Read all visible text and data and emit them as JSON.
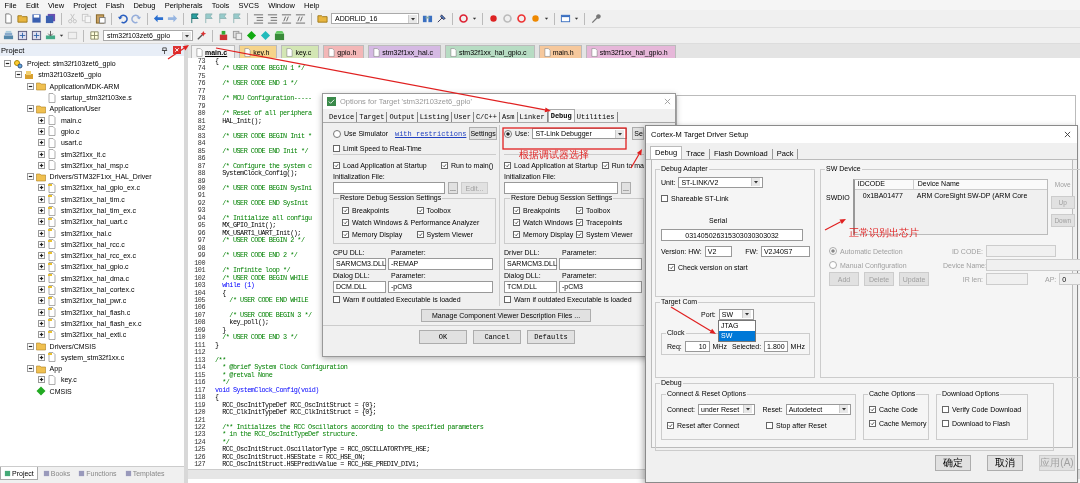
{
  "menu_bar": [
    "File",
    "Edit",
    "View",
    "Project",
    "Flash",
    "Debug",
    "Peripherals",
    "Tools",
    "SVCS",
    "Window",
    "Help"
  ],
  "toolbar": {
    "address_combo": "ADDRLID_16",
    "target_combo": "stm32f103zet6_gpio"
  },
  "project_panel": {
    "title": "Project",
    "tree": [
      {
        "label": "Project: stm32f103zet6_gpio",
        "kind": "project",
        "expanded": true,
        "children": [
          {
            "label": "stm32f103zet6_gpio",
            "kind": "target",
            "expanded": true,
            "children": [
              {
                "label": "Application/MDK-ARM",
                "kind": "folder",
                "expanded": true,
                "children": [
                  {
                    "label": "startup_stm32f103xe.s",
                    "kind": "startup"
                  }
                ]
              },
              {
                "label": "Application/User",
                "kind": "folder",
                "expanded": true,
                "children": [
                  {
                    "label": "main.c",
                    "kind": "user",
                    "expanded": false
                  },
                  {
                    "label": "gpio.c",
                    "kind": "user",
                    "expanded": false
                  },
                  {
                    "label": "usart.c",
                    "kind": "user",
                    "expanded": false
                  },
                  {
                    "label": "stm32f1xx_it.c",
                    "kind": "user",
                    "expanded": false
                  },
                  {
                    "label": "stm32f1xx_hal_msp.c",
                    "kind": "user",
                    "expanded": false
                  }
                ]
              },
              {
                "label": "Drivers/STM32F1xx_HAL_Driver",
                "kind": "folder",
                "expanded": true,
                "children": [
                  {
                    "label": "stm32f1xx_hal_gpio_ex.c",
                    "kind": "lib",
                    "expanded": false
                  },
                  {
                    "label": "stm32f1xx_hal_tim.c",
                    "kind": "lib",
                    "expanded": false
                  },
                  {
                    "label": "stm32f1xx_hal_tim_ex.c",
                    "kind": "lib",
                    "expanded": false
                  },
                  {
                    "label": "stm32f1xx_hal_uart.c",
                    "kind": "lib",
                    "expanded": false
                  },
                  {
                    "label": "stm32f1xx_hal.c",
                    "kind": "lib",
                    "expanded": false
                  },
                  {
                    "label": "stm32f1xx_hal_rcc.c",
                    "kind": "lib",
                    "expanded": false
                  },
                  {
                    "label": "stm32f1xx_hal_rcc_ex.c",
                    "kind": "lib",
                    "expanded": false
                  },
                  {
                    "label": "stm32f1xx_hal_gpio.c",
                    "kind": "lib",
                    "expanded": false
                  },
                  {
                    "label": "stm32f1xx_hal_dma.c",
                    "kind": "lib",
                    "expanded": false
                  },
                  {
                    "label": "stm32f1xx_hal_cortex.c",
                    "kind": "lib",
                    "expanded": false
                  },
                  {
                    "label": "stm32f1xx_hal_pwr.c",
                    "kind": "lib",
                    "expanded": false
                  },
                  {
                    "label": "stm32f1xx_hal_flash.c",
                    "kind": "lib",
                    "expanded": false
                  },
                  {
                    "label": "stm32f1xx_hal_flash_ex.c",
                    "kind": "lib",
                    "expanded": false
                  },
                  {
                    "label": "stm32f1xx_hal_exti.c",
                    "kind": "lib",
                    "expanded": false
                  }
                ]
              },
              {
                "label": "Drivers/CMSIS",
                "kind": "folder",
                "expanded": true,
                "children": [
                  {
                    "label": "system_stm32f1xx.c",
                    "kind": "lib",
                    "expanded": false
                  }
                ]
              },
              {
                "label": "App",
                "kind": "folder",
                "expanded": true,
                "children": [
                  {
                    "label": "key.c",
                    "kind": "user",
                    "expanded": false
                  }
                ]
              },
              {
                "label": "CMSIS",
                "kind": "component"
              }
            ]
          }
        ]
      }
    ],
    "tabs": [
      {
        "label": "Project",
        "selected": true
      },
      {
        "label": "Books",
        "selected": false
      },
      {
        "label": "Functions",
        "selected": false
      },
      {
        "label": "Templates",
        "selected": false
      }
    ]
  },
  "editor": {
    "tabs": [
      {
        "label": "main.c",
        "selected": true,
        "color": "#f4f4f4"
      },
      {
        "label": "key.h",
        "selected": false,
        "color": "#f6d48a"
      },
      {
        "label": "key.c",
        "selected": false,
        "color": "#d3e6b4"
      },
      {
        "label": "gpio.h",
        "selected": false,
        "color": "#f3b7b7"
      },
      {
        "label": "stm32f1xx_hal.c",
        "selected": false,
        "color": "#d5b9e3"
      },
      {
        "label": "stm32f1xx_hal_gpio.c",
        "selected": false,
        "color": "#b7dcc3"
      },
      {
        "label": "main.h",
        "selected": false,
        "color": "#f6c89c"
      },
      {
        "label": "stm32f1xx_hal_gpio.h",
        "selected": false,
        "color": "#e6b7d9"
      }
    ],
    "lines": [
      {
        "number": "73",
        "text": "{",
        "kind": "code"
      },
      {
        "number": "74",
        "text": "  /* USER CODE BEGIN 1 */",
        "kind": "comment"
      },
      {
        "number": "75"
      },
      {
        "number": "76",
        "text": "  /* USER CODE END 1 */",
        "kind": "comment"
      },
      {
        "number": "77"
      },
      {
        "number": "78",
        "text": "  /* MCU Configuration-----",
        "kind": "comment"
      },
      {
        "number": "79"
      },
      {
        "number": "80",
        "text": "  /* Reset of all periphera",
        "kind": "comment"
      },
      {
        "number": "81",
        "text": "  HAL_Init();",
        "kind": "code"
      },
      {
        "number": "82"
      },
      {
        "number": "83",
        "text": "  /* USER CODE BEGIN Init *",
        "kind": "comment"
      },
      {
        "number": "84"
      },
      {
        "number": "85",
        "text": "  /* USER CODE END Init */",
        "kind": "comment"
      },
      {
        "number": "86"
      },
      {
        "number": "87",
        "text": "  /* Configure the system c",
        "kind": "comment"
      },
      {
        "number": "88",
        "text": "  SystemClock_Config();",
        "kind": "code"
      },
      {
        "number": "89"
      },
      {
        "number": "90",
        "text": "  /* USER CODE BEGIN SysIni",
        "kind": "comment"
      },
      {
        "number": "91"
      },
      {
        "number": "92",
        "text": "  /* USER CODE END SysInit",
        "kind": "comment"
      },
      {
        "number": "93"
      },
      {
        "number": "94",
        "text": "  /* Initialize all configu",
        "kind": "comment"
      },
      {
        "number": "95",
        "text": "  MX_GPIO_Init();",
        "kind": "code"
      },
      {
        "number": "96",
        "text": "  MX_USART1_UART_Init();",
        "kind": "code"
      },
      {
        "number": "97",
        "text": "  /* USER CODE BEGIN 2 */",
        "kind": "comment"
      },
      {
        "number": "98"
      },
      {
        "number": "99",
        "text": "  /* USER CODE END 2 */",
        "kind": "comment"
      },
      {
        "number": "100"
      },
      {
        "number": "101",
        "text": "  /* Infinite loop */",
        "kind": "comment"
      },
      {
        "number": "102",
        "text": "  /* USER CODE BEGIN WHILE",
        "kind": "comment"
      },
      {
        "number": "103",
        "text": "  while (1)",
        "kind": "keyword"
      },
      {
        "number": "104",
        "text": "  {",
        "kind": "code"
      },
      {
        "number": "105",
        "text": "    /* USER CODE END WHILE",
        "kind": "comment"
      },
      {
        "number": "106"
      },
      {
        "number": "107",
        "text": "    /* USER CODE BEGIN 3 */",
        "kind": "comment"
      },
      {
        "number": "108",
        "text": "    key_poll();",
        "kind": "code"
      },
      {
        "number": "109",
        "text": "  }",
        "kind": "code"
      },
      {
        "number": "110",
        "text": "  /* USER CODE END 3 */",
        "kind": "comment"
      },
      {
        "number": "111",
        "text": "}",
        "kind": "code"
      },
      {
        "number": "112"
      },
      {
        "number": "113",
        "text": "/**",
        "kind": "comment"
      },
      {
        "number": "114",
        "text": "  * @brief System Clock Configuration",
        "kind": "comment"
      },
      {
        "number": "115",
        "text": "  * @retval None",
        "kind": "comment"
      },
      {
        "number": "116",
        "text": "  */",
        "kind": "comment"
      },
      {
        "number": "117",
        "text": "void SystemClock_Config(void)",
        "kind": "keyword"
      },
      {
        "number": "118",
        "text": "{",
        "kind": "code"
      },
      {
        "number": "119",
        "text": "  RCC_OscInitTypeDef RCC_OscInitStruct = {0};",
        "kind": "code"
      },
      {
        "number": "120",
        "text": "  RCC_ClkInitTypeDef RCC_ClkInitStruct = {0};",
        "kind": "code"
      },
      {
        "number": "121"
      },
      {
        "number": "122",
        "text": "  /** Initializes the RCC Oscillators according to the specified parameters",
        "kind": "comment"
      },
      {
        "number": "123",
        "text": "  * in the RCC_OscInitTypeDef structure.",
        "kind": "comment"
      },
      {
        "number": "124",
        "text": "  */",
        "kind": "comment"
      },
      {
        "number": "125",
        "text": "  RCC_OscInitStruct.OscillatorType = RCC_OSCILLATORTYPE_HSE;",
        "kind": "code"
      },
      {
        "number": "126",
        "text": "  RCC_OscInitStruct.HSEState = RCC_HSE_ON;",
        "kind": "code"
      },
      {
        "number": "127",
        "text": "  RCC_OscInitStruct.HSEPredivValue = RCC_HSE_PREDIV_DIV1;",
        "kind": "code"
      }
    ]
  },
  "options_dialog": {
    "title": "Options for Target 'stm32f103zet6_gpio'",
    "tabs": [
      {
        "label": "Device",
        "selected": false
      },
      {
        "label": "Target",
        "selected": false
      },
      {
        "label": "Output",
        "selected": false
      },
      {
        "label": "Listing",
        "selected": false
      },
      {
        "label": "User",
        "selected": false
      },
      {
        "label": "C/C++",
        "selected": false
      },
      {
        "label": "Asm",
        "selected": false
      },
      {
        "label": "Linker",
        "selected": false
      },
      {
        "label": "Debug",
        "selected": true
      },
      {
        "label": "Utilities",
        "selected": false
      }
    ],
    "left": {
      "simulator": {
        "label": "Use Simulator",
        "selected": false
      },
      "link": "with restrictions",
      "settings_button": "Settings",
      "limit_speed": {
        "label": "Limit Speed to Real-Time",
        "checked": false
      },
      "load_app": {
        "label": "Load Application at Startup",
        "checked": true
      },
      "run_main": {
        "label": "Run to main()",
        "checked": true
      },
      "init_file_label": "Initialization File:",
      "browse_button": "...",
      "edit_button": {
        "label": "Edit...",
        "disabled": true
      },
      "restore_title": "Restore Debug Session Settings",
      "restore": [
        {
          "label": "Breakpoints",
          "checked": true
        },
        {
          "label": "Toolbox",
          "checked": true
        },
        {
          "label": "Watch Windows & Performance Analyzer",
          "checked": true
        },
        {
          "label": "Memory Display",
          "checked": true
        },
        {
          "label": "System Viewer",
          "checked": true
        }
      ],
      "dll_label": "CPU DLL:",
      "dll": "SARMCM3.DLL",
      "param_label": "Parameter:",
      "param": "-REMAP",
      "dialog_dll_label": "Dialog DLL:",
      "dialog_dll": "DCM.DLL",
      "dialog_param_label": "Parameter:",
      "dialog_param": "-pCM3",
      "warn": {
        "label": "Warn if outdated Executable is loaded",
        "checked": false
      }
    },
    "right": {
      "use": {
        "label": "Use:",
        "selected": true
      },
      "debugger": "ST-Link Debugger",
      "settings_button": "Se",
      "load_app": {
        "label": "Load Application at Startup",
        "checked": true
      },
      "run_main": {
        "label": "Run to ma",
        "checked": true
      },
      "init_file_label": "Initialization File:",
      "browse_button": "...",
      "restore_title": "Restore Debug Session Settings",
      "restore": [
        {
          "label": "Breakpoints",
          "checked": true
        },
        {
          "label": "Toolbox",
          "checked": true
        },
        {
          "label": "Watch Windows",
          "checked": true
        },
        {
          "label": "Tracepoints",
          "checked": true
        },
        {
          "label": "Memory Display",
          "checked": true
        },
        {
          "label": "System Viewer",
          "checked": true
        }
      ],
      "dll_label": "Driver DLL:",
      "dll": "SARMCM3.DLL",
      "param_label": "Parameter:",
      "dialog_dll_label": "Dialog DLL:",
      "dialog_dll": "TCM.DLL",
      "dialog_param_label": "Parameter:",
      "dialog_param": "-pCM3",
      "warn": {
        "label": "Warn if outdated Executable is loaded",
        "checked": false
      }
    },
    "manage_button": "Manage Component Viewer Description Files ...",
    "buttons": [
      "OK",
      "Cancel",
      "Defaults"
    ]
  },
  "target_driver_dialog": {
    "title": "Cortex-M Target Driver Setup",
    "tabs": [
      {
        "label": "Debug",
        "selected": true
      },
      {
        "label": "Trace",
        "selected": false
      },
      {
        "label": "Flash Download",
        "selected": false
      },
      {
        "label": "Pack",
        "selected": false
      }
    ],
    "debug_adapter": {
      "title": "Debug Adapter",
      "unit_label": "Unit:",
      "unit": "ST-LINK/V2",
      "shareable": {
        "label": "Shareable ST-Link",
        "checked": false
      },
      "serial_label": "Serial",
      "serial": "031405026315303030303032",
      "hw_label": "Version: HW:",
      "hw": "V2",
      "fw_label": "FW:",
      "fw": "V2J40S7",
      "check_version": {
        "label": "Check version on start",
        "checked": true
      }
    },
    "sw_device": {
      "title": "SW Device",
      "columns": [
        "IDCODE",
        "Device Name"
      ],
      "row_label": "SWDIO",
      "rows": [
        {
          "idcode": "0x1BA01477",
          "device_name": "ARM CoreSight SW-DP (ARM Core"
        }
      ],
      "side_buttons": [
        {
          "label": "Move",
          "disabled": true
        },
        {
          "label": "Up",
          "disabled": true
        },
        {
          "label": "Down",
          "disabled": true
        }
      ],
      "detection": [
        {
          "label": "Automatic Detection",
          "selected": true
        },
        {
          "label": "Manual Configuration",
          "selected": false
        }
      ],
      "id_code_label": "ID CODE:",
      "device_name_label": "Device Name:",
      "buttons": [
        {
          "label": "Add",
          "disabled": true
        },
        {
          "label": "Delete",
          "disabled": true
        },
        {
          "label": "Update",
          "disabled": true
        }
      ],
      "ir_len_label": "IR len:",
      "ap_label": "AP:",
      "ap": "0"
    },
    "target_com": {
      "title": "Target Com",
      "port_label": "Port:",
      "port": "SW",
      "port_options": [
        {
          "label": "JTAG",
          "selected": false
        },
        {
          "label": "SW",
          "selected": true
        }
      ],
      "clock_title": "Clock",
      "req_label": "Req:",
      "req": "10",
      "req_unit": "MHz",
      "selected_label": "Selected:",
      "selected_value": "1.800",
      "selected_unit": "MHz"
    },
    "debug": {
      "title": "Debug",
      "connect_reset": {
        "title": "Connect & Reset Options",
        "connect_label": "Connect:",
        "connect": "under Reset",
        "reset_label": "Reset:",
        "reset": "Autodetect",
        "reset_after_connect": {
          "label": "Reset after Connect",
          "checked": true
        },
        "stop_after_reset": {
          "label": "Stop after Reset",
          "checked": false
        }
      },
      "cache": {
        "title": "Cache Options",
        "items": [
          {
            "label": "Cache Code",
            "checked": true
          },
          {
            "label": "Cache Memory",
            "checked": true
          }
        ]
      },
      "download": {
        "title": "Download Options",
        "items": [
          {
            "label": "Verify Code Download",
            "checked": false
          },
          {
            "label": "Download to Flash",
            "checked": false
          }
        ]
      }
    },
    "buttons": [
      {
        "label": "确定",
        "disabled": false
      },
      {
        "label": "取消",
        "disabled": false
      },
      {
        "label": "应用(A)",
        "disabled": true
      }
    ]
  },
  "annotations": [
    {
      "text": "根据调试器选择"
    },
    {
      "text": "正常识别出芯片"
    }
  ]
}
